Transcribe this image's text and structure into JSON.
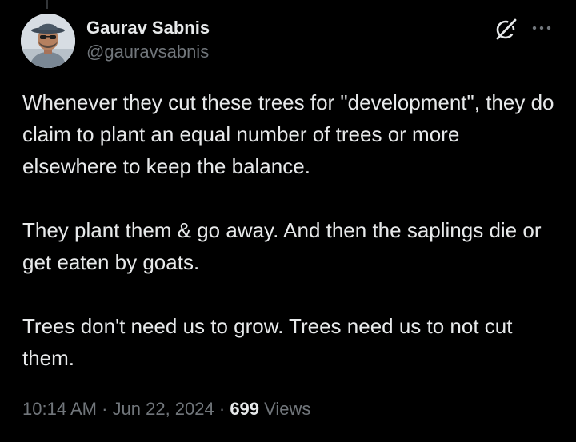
{
  "author": {
    "display_name": "Gaurav Sabnis",
    "handle": "@gauravsabnis"
  },
  "tweet": {
    "paragraphs": [
      "Whenever they cut these trees for \"development\", they do claim to plant an equal number of trees or more elsewhere to keep the balance.",
      "They plant them & go away. And then the saplings die or get eaten by goats.",
      "Trees don't need us to grow. Trees need us to not cut them."
    ]
  },
  "meta": {
    "time": "10:14 AM",
    "separator": " · ",
    "date": "Jun 22, 2024",
    "views_count": "699",
    "views_label": " Views"
  },
  "icons": {
    "grok": "grok-icon",
    "more": "more-options-icon",
    "avatar": "profile-avatar"
  },
  "colors": {
    "background": "#000000",
    "primary_text": "#e7e9ea",
    "secondary_text": "#71767b"
  }
}
